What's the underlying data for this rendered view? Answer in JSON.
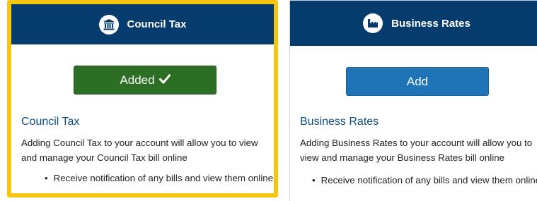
{
  "cards": [
    {
      "header_title": "Council Tax",
      "header_icon": "building-icon",
      "button_label": "Added",
      "button_icon": "checkmark-icon",
      "title": "Council Tax",
      "description": "Adding Council Tax to your account will allow you to view and manage your Council Tax bill online",
      "bullet": "Receive notification of any bills and view them online",
      "selected": true
    },
    {
      "header_title": "Business Rates",
      "header_icon": "factory-icon",
      "button_label": "Add",
      "title": "Business Rates",
      "description": "Adding Business Rates to your account will allow you to view and manage your Business Rates bill online",
      "bullet": "Receive notification of any bills and view them online",
      "selected": false
    }
  ],
  "colors": {
    "header_bg": "#063b6e",
    "added_button": "#2b6e24",
    "add_button": "#1f73b7",
    "selected_border": "#f6c512",
    "title_text": "#0b4c84"
  }
}
